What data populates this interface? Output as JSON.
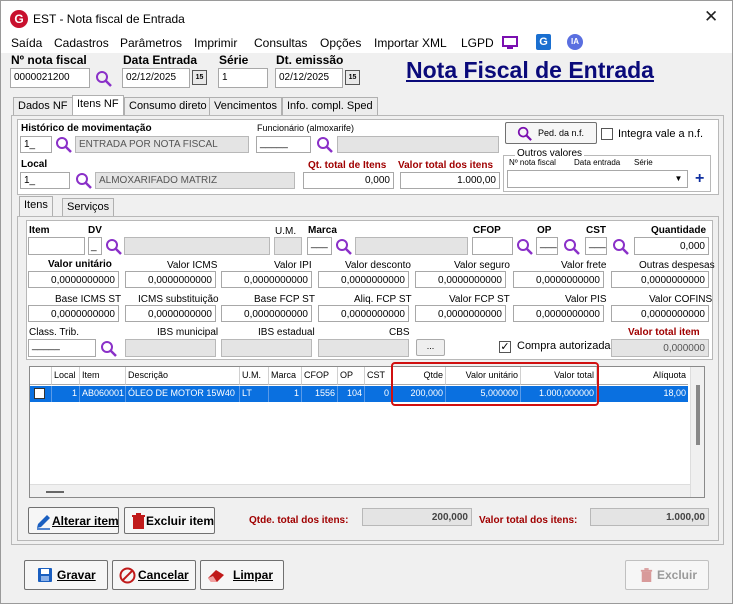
{
  "window": {
    "title": "EST - Nota fiscal de Entrada",
    "logo": "G"
  },
  "menu": [
    "Saída",
    "Cadastros",
    "Parâmetros",
    "Imprimir",
    "Consultas",
    "Opções",
    "Importar XML",
    "LGPD"
  ],
  "menu_icons": {
    "ia_label": "IA",
    "g_label": "G"
  },
  "header": {
    "nota_fiscal_label": "Nº nota fiscal",
    "nota_fiscal_value": "0000021200",
    "data_entrada_label": "Data Entrada",
    "data_entrada_value": "02/12/2025",
    "serie_label": "Série",
    "serie_value": "1",
    "dt_emissao_label": "Dt. emissão",
    "dt_emissao_value": "02/12/2025",
    "page_title": "Nota Fiscal de Entrada",
    "cal_label": "15"
  },
  "tabs": [
    "Dados NF",
    "Itens NF",
    "Consumo direto",
    "Vencimentos",
    "Info. compl. Sped"
  ],
  "top_section": {
    "historico_label": "Histórico de movimentação",
    "historico_code": "1_",
    "historico_desc": "ENTRADA POR NOTA FISCAL",
    "funcionario_label": "Funcionário (almoxarife)",
    "funcionario_value": "_____",
    "ped_button": "Ped. da n.f.",
    "integra_label": "Integra vale a n.f.",
    "local_label": "Local",
    "local_code": "1_",
    "local_desc": "ALMOXARIFADO MATRIZ",
    "qt_total_label": "Qt. total de Itens",
    "qt_total_value": "0,000",
    "valor_total_label": "Valor total dos itens",
    "valor_total_value": "1.000,00",
    "outros_valores_label": "Outros valores",
    "nf_col": "Nº nota fiscal",
    "data_col": "Data entrada",
    "serie_col": "Série",
    "plus": "+"
  },
  "subtabs": [
    "Itens",
    "Serviços"
  ],
  "item_form": {
    "item_label": "Item",
    "dv_label": "DV",
    "dv_value": "_",
    "um_label": "U.M.",
    "marca_label": "Marca",
    "marca_value": "___",
    "cfop_label": "CFOP",
    "op_label": "OP",
    "op_value": "___",
    "cst_label": "CST",
    "cst_value": "___",
    "quantidade_label": "Quantidade",
    "quantidade_value": "0,000",
    "row2_labels": [
      "Valor unitário",
      "Valor ICMS",
      "Valor IPI",
      "Valor desconto",
      "Valor seguro",
      "Valor frete",
      "Outras despesas"
    ],
    "row2_values": [
      "0,0000000000",
      "0,0000000000",
      "0,0000000000",
      "0,0000000000",
      "0,0000000000",
      "0,0000000000",
      "0,0000000000"
    ],
    "row3_labels": [
      "Base ICMS ST",
      "ICMS substituição",
      "Base FCP ST",
      "Aliq. FCP ST",
      "Valor FCP ST",
      "Valor PIS",
      "Valor COFINS"
    ],
    "row3_values": [
      "0,0000000000",
      "0,0000000000",
      "0,0000000000",
      "0,0000000000",
      "0,0000000000",
      "0,0000000000",
      "0,0000000000"
    ],
    "class_trib_label": "Class. Trib.",
    "class_trib_value": "_____",
    "ibs_municipal_label": "IBS municipal",
    "ibs_estadual_label": "IBS estadual",
    "cbs_label": "CBS",
    "dots": "...",
    "compra_autorizada_label": "Compra autorizada",
    "compra_autorizada_checked": true,
    "valor_total_item_label": "Valor total item",
    "valor_total_item_value": "0,000000"
  },
  "grid": {
    "headers": [
      "",
      "Local",
      "Item",
      "Descrição",
      "U.M.",
      "Marca",
      "CFOP",
      "OP",
      "CST",
      "Qtde",
      "Valor unitário",
      "Valor total",
      "Alíquota"
    ],
    "rows": [
      [
        "",
        "1",
        "AB060001",
        "ÓLEO DE MOTOR 15W40",
        "LT",
        "1",
        "1556",
        "104",
        "0",
        "200,000",
        "5,000000",
        "1.000,000000",
        "18,00"
      ]
    ],
    "highlight_color": "#d01010",
    "selection_color": "#0a70e0"
  },
  "bottom": {
    "alterar_label": "Alterar item",
    "excluir_item_label": "Excluir item",
    "qtde_total_label": "Qtde. total dos itens:",
    "qtde_total_value": "200,000",
    "valor_total_label": "Valor total dos itens:",
    "valor_total_value": "1.000,00"
  },
  "footer": {
    "gravar": "Gravar",
    "cancelar": "Cancelar",
    "limpar": "Limpar",
    "excluir": "Excluir"
  }
}
